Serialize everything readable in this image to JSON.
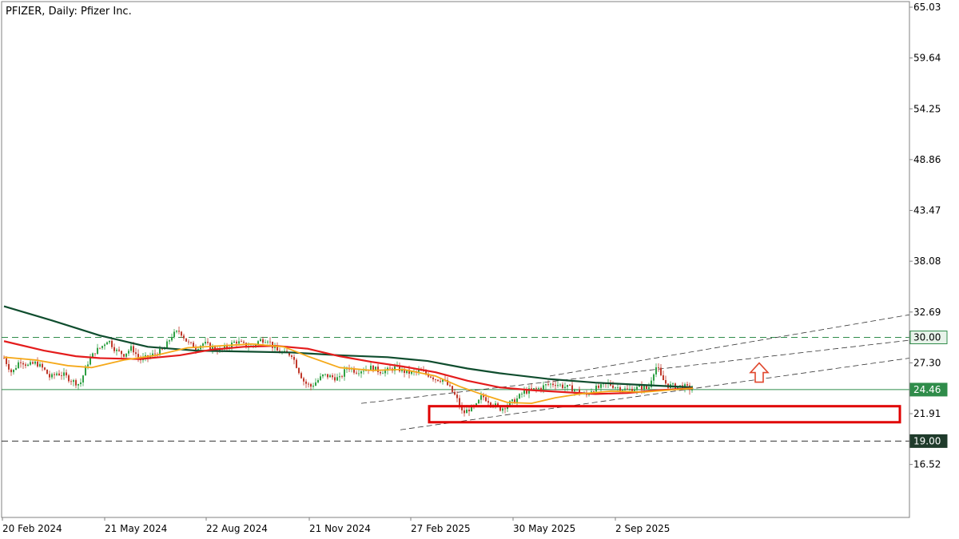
{
  "chart_data": {
    "type": "candlestick",
    "title": "PFIZER, Daily:  Pfizer Inc.",
    "x_ticks": [
      "20 Feb 2024",
      "21 May 2024",
      "22 Aug 2024",
      "21 Nov 2024",
      "27 Feb 2025",
      "30 May 2025",
      "2 Sep 2025"
    ],
    "y_ticks": [
      65.03,
      59.64,
      54.25,
      48.86,
      43.47,
      38.08,
      32.69,
      27.3,
      21.91,
      16.52
    ],
    "ylim": [
      10.9,
      65.03
    ],
    "price_path": [
      [
        0,
        27.8
      ],
      [
        10,
        26.2
      ],
      [
        20,
        27.6
      ],
      [
        30,
        27.0
      ],
      [
        40,
        27.3
      ],
      [
        50,
        26.6
      ],
      [
        58,
        25.7
      ],
      [
        66,
        26.2
      ],
      [
        75,
        26.0
      ],
      [
        85,
        25.4
      ],
      [
        95,
        25.0
      ],
      [
        104,
        27.2
      ],
      [
        114,
        28.5
      ],
      [
        122,
        29.0
      ],
      [
        130,
        29.8
      ],
      [
        140,
        28.6
      ],
      [
        150,
        28.2
      ],
      [
        160,
        28.9
      ],
      [
        170,
        27.6
      ],
      [
        180,
        27.9
      ],
      [
        190,
        28.3
      ],
      [
        200,
        28.7
      ],
      [
        210,
        30.2
      ],
      [
        220,
        30.7
      ],
      [
        230,
        29.4
      ],
      [
        240,
        28.9
      ],
      [
        250,
        29.4
      ],
      [
        260,
        28.9
      ],
      [
        270,
        28.6
      ],
      [
        280,
        29.0
      ],
      [
        290,
        29.6
      ],
      [
        300,
        29.2
      ],
      [
        310,
        29.0
      ],
      [
        320,
        29.7
      ],
      [
        330,
        29.8
      ],
      [
        340,
        28.6
      ],
      [
        350,
        28.3
      ],
      [
        360,
        28.2
      ],
      [
        368,
        26.6
      ],
      [
        376,
        25.2
      ],
      [
        384,
        24.8
      ],
      [
        392,
        25.4
      ],
      [
        400,
        26.0
      ],
      [
        410,
        25.8
      ],
      [
        420,
        25.6
      ],
      [
        430,
        26.9
      ],
      [
        440,
        26.4
      ],
      [
        450,
        26.6
      ],
      [
        460,
        26.8
      ],
      [
        470,
        26.4
      ],
      [
        480,
        26.5
      ],
      [
        490,
        26.8
      ],
      [
        500,
        26.4
      ],
      [
        510,
        26.2
      ],
      [
        520,
        26.4
      ],
      [
        530,
        26.1
      ],
      [
        540,
        25.6
      ],
      [
        550,
        25.5
      ],
      [
        558,
        24.6
      ],
      [
        566,
        23.6
      ],
      [
        574,
        21.9
      ],
      [
        582,
        22.4
      ],
      [
        590,
        22.6
      ],
      [
        598,
        23.8
      ],
      [
        606,
        23.3
      ],
      [
        614,
        22.8
      ],
      [
        622,
        22.4
      ],
      [
        630,
        22.9
      ],
      [
        640,
        23.3
      ],
      [
        650,
        24.2
      ],
      [
        660,
        24.4
      ],
      [
        670,
        24.6
      ],
      [
        680,
        25.0
      ],
      [
        690,
        25.1
      ],
      [
        700,
        24.8
      ],
      [
        710,
        24.6
      ],
      [
        720,
        24.2
      ],
      [
        728,
        23.8
      ],
      [
        736,
        24.5
      ],
      [
        746,
        24.7
      ],
      [
        756,
        25.1
      ],
      [
        764,
        24.8
      ],
      [
        772,
        24.6
      ],
      [
        780,
        24.4
      ],
      [
        790,
        24.6
      ],
      [
        800,
        24.7
      ],
      [
        806,
        24.5
      ],
      [
        812,
        26.2
      ],
      [
        817,
        27.0
      ],
      [
        822,
        25.8
      ],
      [
        830,
        24.9
      ],
      [
        840,
        24.8
      ],
      [
        850,
        24.8
      ],
      [
        862,
        24.46
      ]
    ],
    "ma_slow": [
      [
        0,
        33.3
      ],
      [
        60,
        31.8
      ],
      [
        120,
        30.2
      ],
      [
        180,
        29.0
      ],
      [
        240,
        28.6
      ],
      [
        300,
        28.5
      ],
      [
        360,
        28.4
      ],
      [
        420,
        28.1
      ],
      [
        480,
        27.9
      ],
      [
        530,
        27.5
      ],
      [
        580,
        26.7
      ],
      [
        620,
        26.2
      ],
      [
        680,
        25.6
      ],
      [
        740,
        25.2
      ],
      [
        800,
        24.95
      ],
      [
        862,
        24.7
      ]
    ],
    "ma_mid": [
      [
        0,
        29.6
      ],
      [
        50,
        28.6
      ],
      [
        90,
        28.0
      ],
      [
        120,
        27.8
      ],
      [
        170,
        27.7
      ],
      [
        220,
        28.1
      ],
      [
        260,
        28.7
      ],
      [
        300,
        29.0
      ],
      [
        340,
        29.1
      ],
      [
        380,
        28.8
      ],
      [
        420,
        28.0
      ],
      [
        460,
        27.4
      ],
      [
        500,
        26.9
      ],
      [
        540,
        26.3
      ],
      [
        580,
        25.4
      ],
      [
        620,
        24.7
      ],
      [
        660,
        24.4
      ],
      [
        700,
        24.2
      ],
      [
        740,
        24.0
      ],
      [
        780,
        24.1
      ],
      [
        820,
        24.4
      ],
      [
        862,
        24.6
      ]
    ],
    "ma_fast": [
      [
        0,
        27.9
      ],
      [
        40,
        27.6
      ],
      [
        80,
        27.0
      ],
      [
        110,
        26.8
      ],
      [
        150,
        27.6
      ],
      [
        190,
        28.1
      ],
      [
        230,
        28.9
      ],
      [
        270,
        29.1
      ],
      [
        310,
        29.3
      ],
      [
        350,
        29.0
      ],
      [
        380,
        28.0
      ],
      [
        420,
        26.8
      ],
      [
        460,
        26.5
      ],
      [
        500,
        26.6
      ],
      [
        540,
        25.9
      ],
      [
        570,
        24.8
      ],
      [
        600,
        23.9
      ],
      [
        630,
        23.1
      ],
      [
        660,
        23.0
      ],
      [
        690,
        23.6
      ],
      [
        720,
        24.0
      ],
      [
        760,
        24.3
      ],
      [
        800,
        24.2
      ],
      [
        830,
        24.4
      ],
      [
        862,
        24.6
      ]
    ],
    "levels": [
      {
        "label": "30.00",
        "value": 30.0
      },
      {
        "label": "24.46",
        "value": 24.46
      },
      {
        "label": "19.00",
        "value": 19.0
      }
    ],
    "colors": {
      "ma_slow": "#0f4d2e",
      "ma_mid": "#e41c1c",
      "ma_fast": "#f5a91a",
      "level_line": "#2f8c4a",
      "level_tag": "#2f8c4a",
      "dark_tag": "#1f3b2b",
      "box": "#e00000",
      "arrow": "#e0472d",
      "up_candle": "#2ea043",
      "down_candle": "#c0392b"
    }
  }
}
